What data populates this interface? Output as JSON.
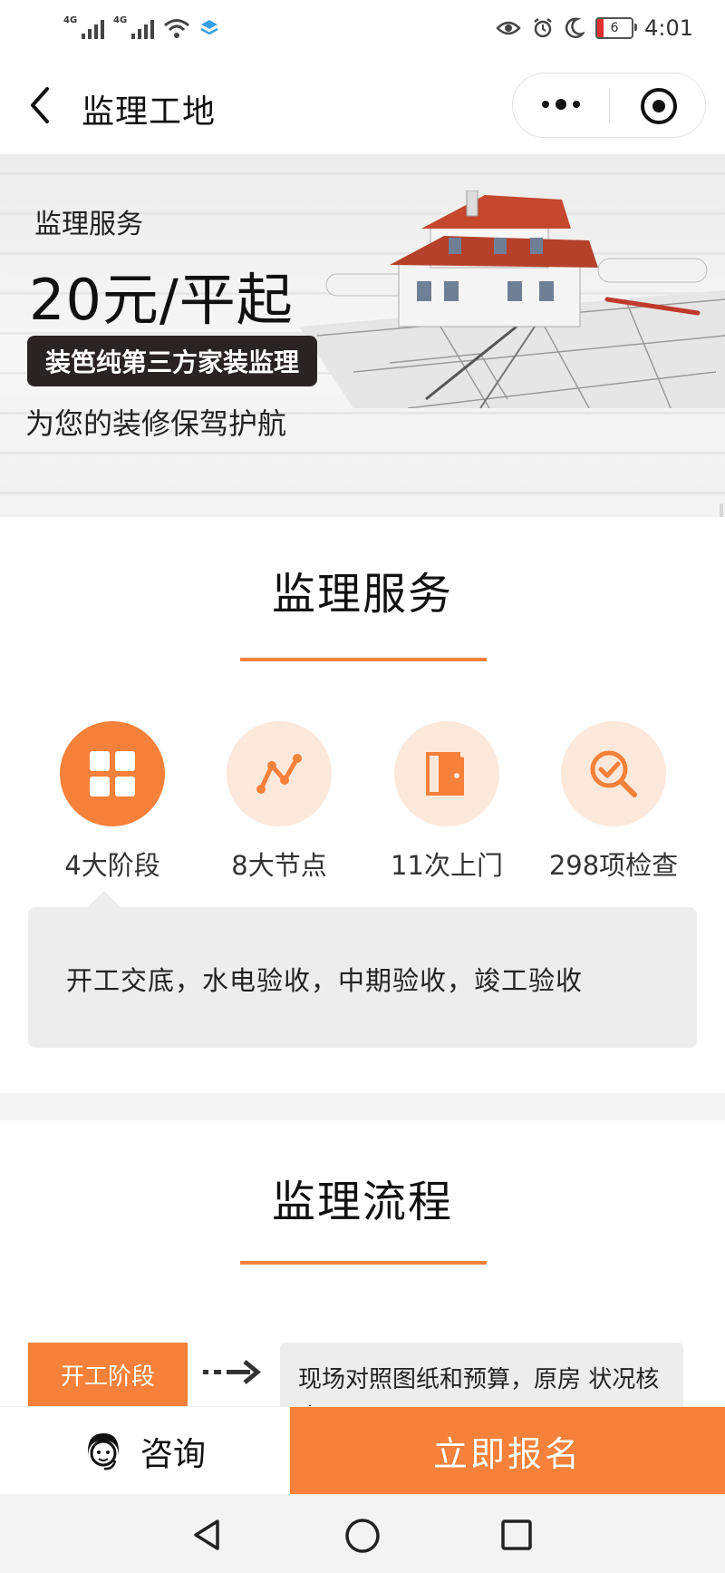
{
  "status_bar": {
    "network_1": "4G",
    "network_2": "4G",
    "battery_level": "6",
    "time": "4:01"
  },
  "nav": {
    "title": "监理工地"
  },
  "banner": {
    "subtitle": "监理服务",
    "price": "20元/平起",
    "tag": "装笆纯第三方家装监理",
    "slogan": "为您的装修保驾护航"
  },
  "services_section": {
    "title": "监理服务",
    "items": [
      {
        "label": "4大阶段",
        "icon": "grid-icon",
        "active": true
      },
      {
        "label": "8大节点",
        "icon": "node-line-icon",
        "active": false
      },
      {
        "label": "11次上门",
        "icon": "door-icon",
        "active": false
      },
      {
        "label": "298项检查",
        "icon": "search-check-icon",
        "active": false
      }
    ],
    "detail": "开工交底，水电验收，中期验收，竣工验收"
  },
  "process_section": {
    "title": "监理流程",
    "stages": [
      {
        "label": "开工阶段",
        "description": "现场对照图纸和预算，原房 状况核查"
      }
    ]
  },
  "action_bar": {
    "consult_label": "咨询",
    "signup_label": "立即报名"
  },
  "colors": {
    "accent": "#f6813a",
    "accent_light": "#fde8dc"
  }
}
